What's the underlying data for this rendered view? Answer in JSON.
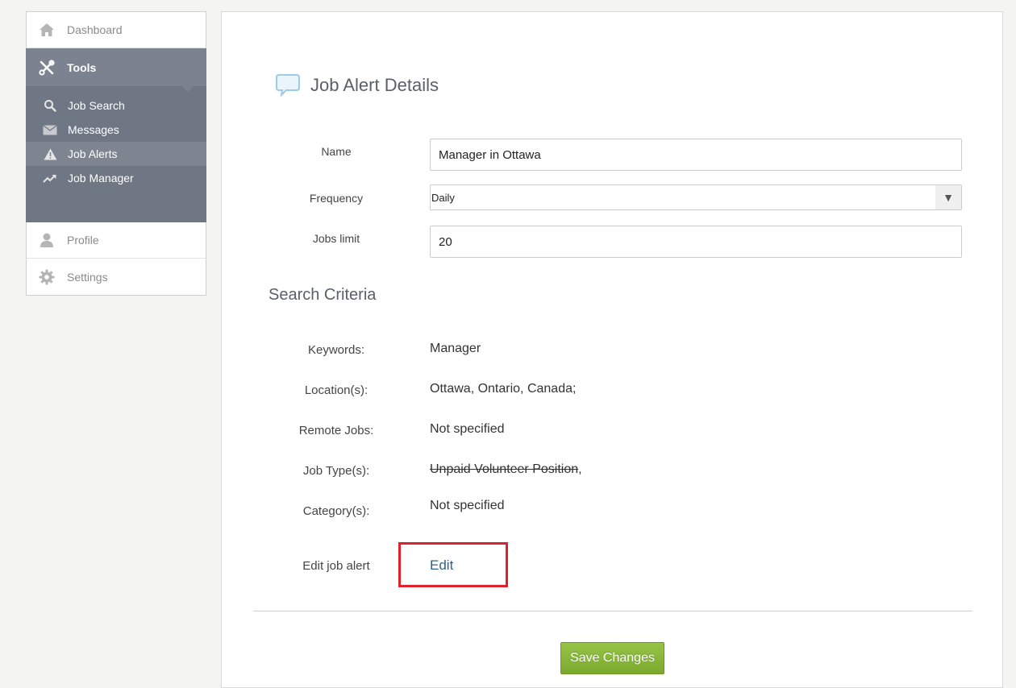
{
  "sidebar": {
    "dashboard": "Dashboard",
    "tools": "Tools",
    "submenu": [
      "Job Search",
      "Messages",
      "Job Alerts",
      "Job Manager"
    ],
    "profile": "Profile",
    "settings": "Settings"
  },
  "main": {
    "title": "Job Alert Details",
    "form": {
      "name_label": "Name",
      "name_value": "Manager in Ottawa",
      "frequency_label": "Frequency",
      "frequency_value": "Daily",
      "jobs_limit_label": "Jobs limit",
      "jobs_limit_value": "20"
    },
    "criteria": {
      "title": "Search Criteria",
      "keywords_label": "Keywords:",
      "keywords_value": "Manager",
      "locations_label": "Location(s):",
      "locations_value": "Ottawa, Ontario, Canada;",
      "remote_label": "Remote Jobs:",
      "remote_value": "Not specified",
      "jobtype_label": "Job Type(s):",
      "jobtype_strike": "Unpaid Volunteer Position",
      "jobtype_suffix": ",",
      "category_label": "Category(s):",
      "category_value": "Not specified"
    },
    "edit_label": "Edit job alert",
    "edit_link": "Edit",
    "save_button": "Save Changes"
  },
  "colors": {
    "tools_bg": "#7b8390",
    "submenu_bg": "#6f7784",
    "highlight_box": "#e0202a",
    "save_button": "#8bb83c",
    "link": "#2f5f86"
  }
}
